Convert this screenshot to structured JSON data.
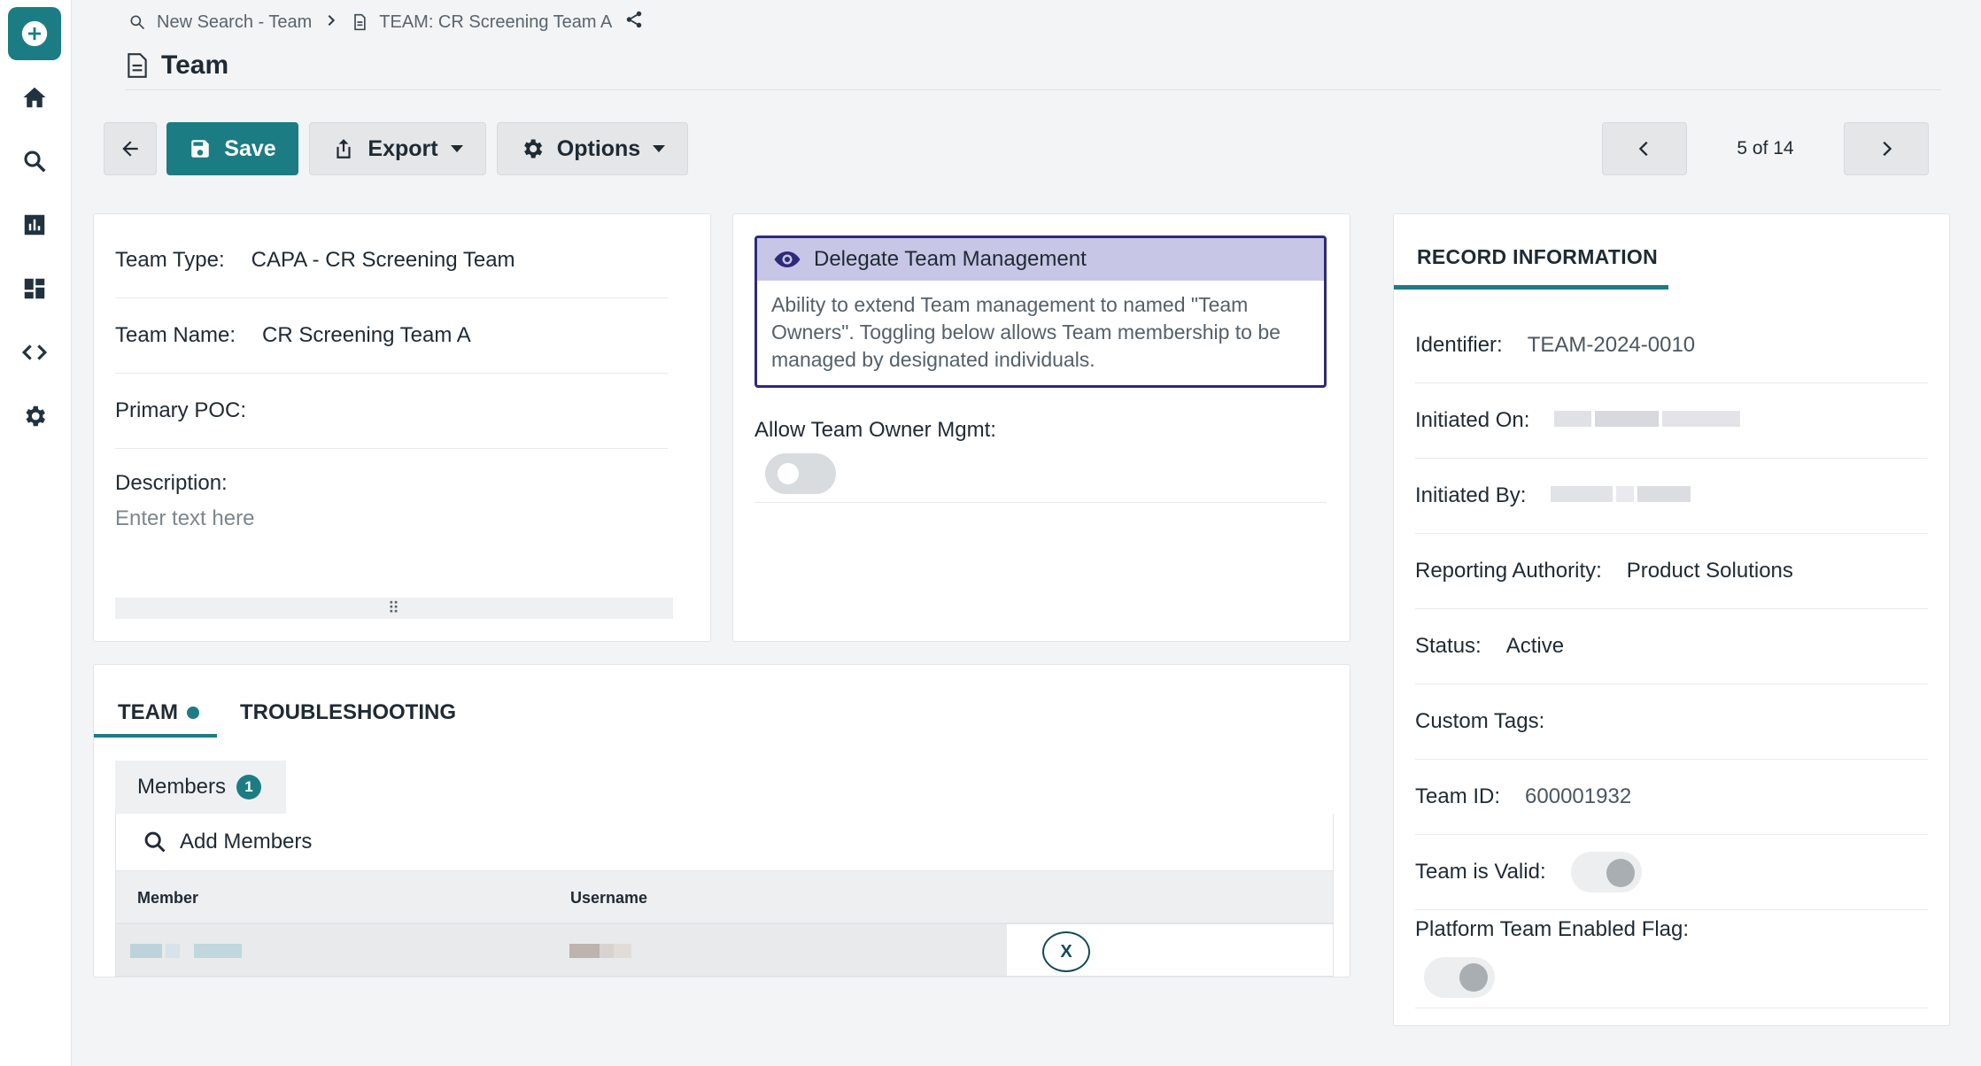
{
  "breadcrumb": {
    "search_label": "New Search - Team",
    "record_label": "TEAM: CR Screening Team A"
  },
  "page": {
    "title": "Team"
  },
  "toolbar": {
    "save_label": "Save",
    "export_label": "Export",
    "options_label": "Options",
    "pager_text": "5 of 14"
  },
  "details": {
    "team_type_label": "Team Type:",
    "team_type_value": "CAPA - CR Screening Team",
    "team_name_label": "Team Name:",
    "team_name_value": "CR Screening Team A",
    "primary_poc_label": "Primary POC:",
    "description_label": "Description:",
    "description_placeholder": "Enter text here",
    "resize_handle": "⠿"
  },
  "delegate": {
    "title": "Delegate Team Management",
    "body": "Ability to extend Team management to named \"Team Owners\".  Toggling below allows Team membership to be managed by designated individuals.",
    "allow_label": "Allow Team Owner Mgmt:",
    "allow_enabled": false
  },
  "tabs": {
    "team_label": "TEAM",
    "troubleshooting_label": "TROUBLESHOOTING"
  },
  "members": {
    "tab_label": "Members",
    "count": "1",
    "add_label": "Add Members",
    "columns": [
      "Member",
      "Username"
    ],
    "remove_label": "X"
  },
  "record_info": {
    "title": "RECORD INFORMATION",
    "identifier_label": "Identifier:",
    "identifier_value": "TEAM-2024-0010",
    "initiated_on_label": "Initiated On:",
    "initiated_by_label": "Initiated By:",
    "reporting_authority_label": "Reporting Authority:",
    "reporting_authority_value": "Product Solutions",
    "status_label": "Status:",
    "status_value": "Active",
    "custom_tags_label": "Custom Tags:",
    "team_id_label": "Team ID:",
    "team_id_value": "600001932",
    "team_valid_label": "Team is Valid:",
    "team_valid": true,
    "platform_flag_label": "Platform Team Enabled Flag:",
    "platform_flag": true
  },
  "colors": {
    "accent": "#1c7c83",
    "delegate_border": "#2d2a7a",
    "delegate_header": "#c7c6e6"
  }
}
